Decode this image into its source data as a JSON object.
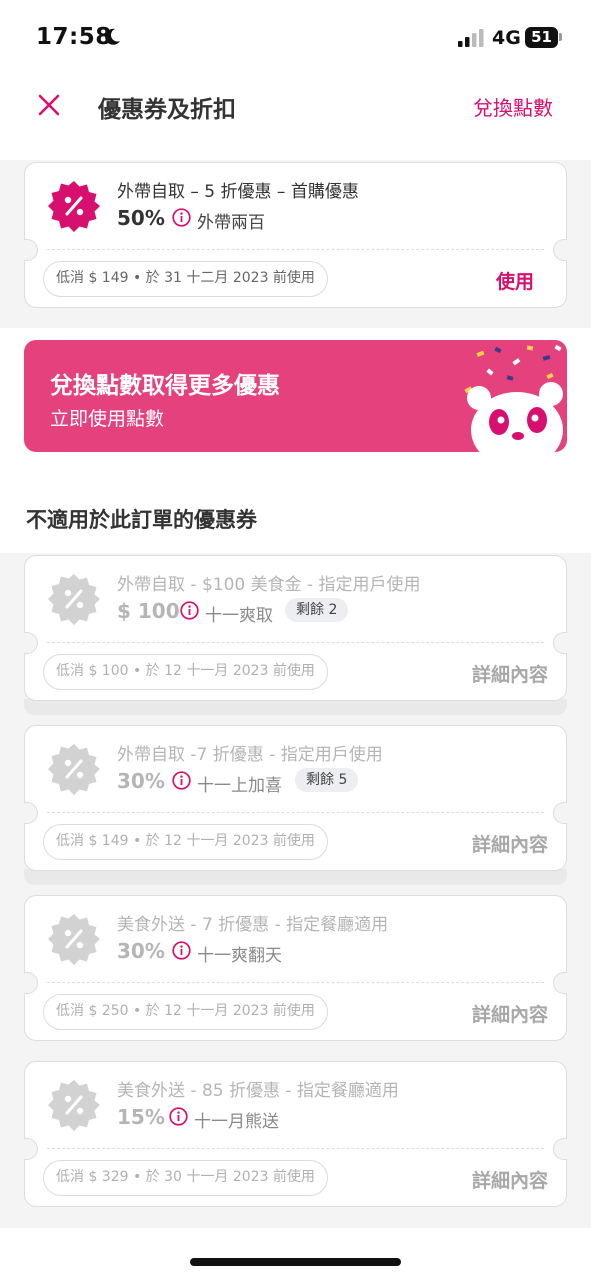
{
  "status_bar": {
    "time": "17:58",
    "network": "4G",
    "battery": "51"
  },
  "header": {
    "title": "優惠券及折扣",
    "redeem_label": "兌換點數"
  },
  "active_voucher": {
    "title": "外帶自取 – 5 折優惠 – 首購優惠",
    "amount": "50%",
    "campaign": "外帶兩百",
    "condition": "低消 $ 149 • 於 31 十二月 2023 前使用",
    "action": "使用"
  },
  "banner": {
    "title": "兌換點數取得更多優惠",
    "subtitle": "立即使用點數"
  },
  "section_heading": "不適用於此訂單的優惠券",
  "inactive_vouchers": [
    {
      "title": "外帶自取 - $100 美食金 - 指定用戶使用",
      "amount": "$ 100",
      "campaign": "十一爽取",
      "remaining": "剩餘 2",
      "condition": "低消 $ 100 • 於 12 十一月 2023 前使用",
      "action": "詳細內容"
    },
    {
      "title": "外帶自取 -7 折優惠 - 指定用戶使用",
      "amount": "30%",
      "campaign": "十一上加喜",
      "remaining": "剩餘 5",
      "condition": "低消 $ 149 • 於 12 十一月 2023 前使用",
      "action": "詳細內容"
    },
    {
      "title": "美食外送 - 7 折優惠 - 指定餐廳適用",
      "amount": "30%",
      "campaign": "十一爽翻天",
      "condition": "低消 $ 250 • 於 12 十一月 2023 前使用",
      "action": "詳細內容"
    },
    {
      "title": "美食外送 - 85 折優惠 - 指定餐廳適用",
      "amount": "15%",
      "campaign": "十一月熊送",
      "condition": "低消 $ 329 • 於 30 十一月 2023 前使用",
      "action": "詳細內容"
    }
  ],
  "colors": {
    "brand": "#d7106f",
    "banner": "#e5417d",
    "disabled": "#b5b5b5",
    "section_bg": "#f4f4f4"
  }
}
